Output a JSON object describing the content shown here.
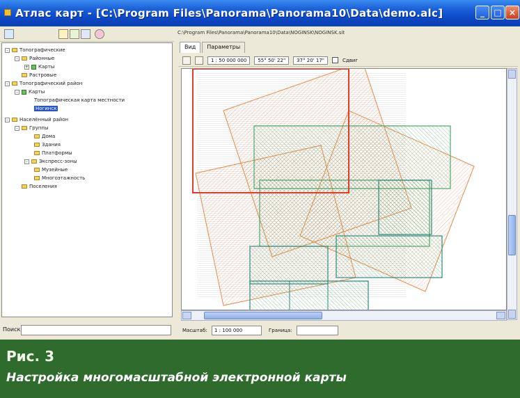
{
  "window": {
    "title": "Атлас карт - [C:\\Program Files\\Panorama\\Panorama10\\Data\\demo.alс]",
    "minimize_icon": "minimize-icon",
    "maximize_icon": "maximize-icon",
    "close_icon": "close-icon"
  },
  "tree": {
    "items": [
      {
        "label": "Топографические",
        "level": 0,
        "kind": "folder"
      },
      {
        "label": "Районные",
        "level": 1,
        "kind": "folder"
      },
      {
        "label": "Карты",
        "level": 2,
        "kind": "layer"
      },
      {
        "label": "Растровые",
        "level": 1,
        "kind": "folder"
      },
      {
        "label": "Топографический район",
        "level": 0,
        "kind": "folder"
      },
      {
        "label": "Карты",
        "level": 1,
        "kind": "layer"
      },
      {
        "label": "Топографическая карта местности",
        "level": 2,
        "kind": "text"
      },
      {
        "label": "Ногинск",
        "level": 2,
        "kind": "selected"
      },
      {
        "label": "Населённый район",
        "level": 0,
        "kind": "folder"
      },
      {
        "label": "Группы",
        "level": 1,
        "kind": "folder"
      },
      {
        "label": "Дома",
        "level": 2,
        "kind": "folder"
      },
      {
        "label": "Здания",
        "level": 2,
        "kind": "folder"
      },
      {
        "label": "Платформы",
        "level": 2,
        "kind": "folder"
      },
      {
        "label": "Экспресс-зоны",
        "level": 1,
        "kind": "folder"
      },
      {
        "label": "Музейные",
        "level": 2,
        "kind": "folder"
      },
      {
        "label": "Многоэтажность",
        "level": 2,
        "kind": "folder"
      },
      {
        "label": "Поселения",
        "level": 1,
        "kind": "folder"
      }
    ],
    "search_label": "Поиск:"
  },
  "right": {
    "path": "C:\\Program Files\\Panorama\\Panorama10\\Data\\NOGINSK\\NOGINSK.sit",
    "tabs": [
      "Вид",
      "Параметры"
    ],
    "scale_field": "1 : 50 000 000",
    "coord_field_1": "55° 50' 22\"",
    "coord_field_2": "37° 20' 17\"",
    "checkbox_label": "Сдвиг",
    "status_label_1": "Масштаб:",
    "status_value_1": "1 : 100 000",
    "status_label_2": "Граница:",
    "status_value_2": ""
  },
  "caption": {
    "figure": "Рис. 3",
    "text": "Настройка многомасштабной электронной карты"
  },
  "colors": {
    "titlebar": "#0c47c4",
    "caption_bg": "#2e6b2d",
    "map_orange": "#e8894a",
    "map_green": "#4aa86a",
    "map_red_frame": "#e83a2a",
    "map_teal": "#2a8a7a"
  }
}
